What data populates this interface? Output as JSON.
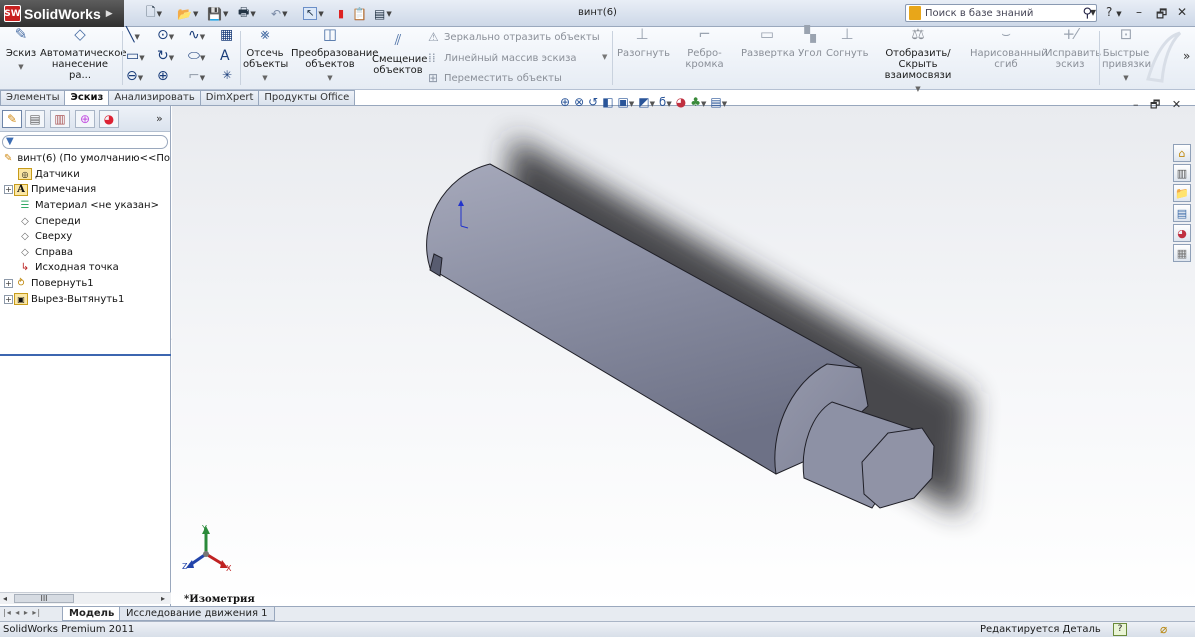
{
  "app": {
    "logo_text": "SolidWorks",
    "logo_badge": "SW",
    "document_title": "винт(6)"
  },
  "search": {
    "placeholder": "Поиск в базе знаний"
  },
  "colors": {
    "accent": "#4a6fa5",
    "logo_red": "#c8201f",
    "selection_blue": "#3c66b0",
    "model_gray": "#8b8fa3"
  },
  "ribbon": {
    "sketch": "Эскиз",
    "smart_dimension": "Автоматическое нанесение ра...",
    "trim": "Отсечь объекты",
    "convert": "Преобразование объектов",
    "offset": "Смещение объектов",
    "mirror": "Зеркально отразить объекты",
    "linear_pattern": "Линейный массив эскиза",
    "move": "Переместить объекты",
    "unfold": "Разогнуть",
    "edge_flange": "Ребро-кромка",
    "flatten": "Развертка",
    "corner": "Угол",
    "fold": "Согнуть",
    "display_relations": "Отобразить/Скрыть взаимосвязи",
    "sketched_bend": "Нарисованный сгиб",
    "repair_sketch": "Исправить эскиз",
    "quick_snaps": "Быстрые привязки"
  },
  "tabs": [
    "Элементы",
    "Эскиз",
    "Анализировать",
    "DimXpert",
    "Продукты Office"
  ],
  "active_tab": "Эскиз",
  "tree": {
    "root": "винт(6)  (По умолчанию<<По",
    "items": [
      "Датчики",
      "Примечания",
      "Материал <не указан>",
      "Спереди",
      "Сверху",
      "Справа",
      "Исходная точка",
      "Повернуть1",
      "Вырез-Вытянуть1"
    ]
  },
  "viewport": {
    "view_name": "*Изометрия",
    "axis_x": "X",
    "axis_y": "Y",
    "axis_z": "Z"
  },
  "bottom_tabs": [
    "Модель",
    "Исследование движения 1"
  ],
  "status": {
    "left": "SolidWorks Premium 2011",
    "right": "Редактируется Деталь",
    "help": "?"
  },
  "icons": [
    "search-icon",
    "help-icon",
    "minimize-icon",
    "restore-icon",
    "close-icon",
    "filter-icon",
    "feature-manager-icon",
    "property-manager-icon",
    "configuration-manager-icon",
    "dimxpert-manager-icon",
    "display-manager-icon"
  ]
}
